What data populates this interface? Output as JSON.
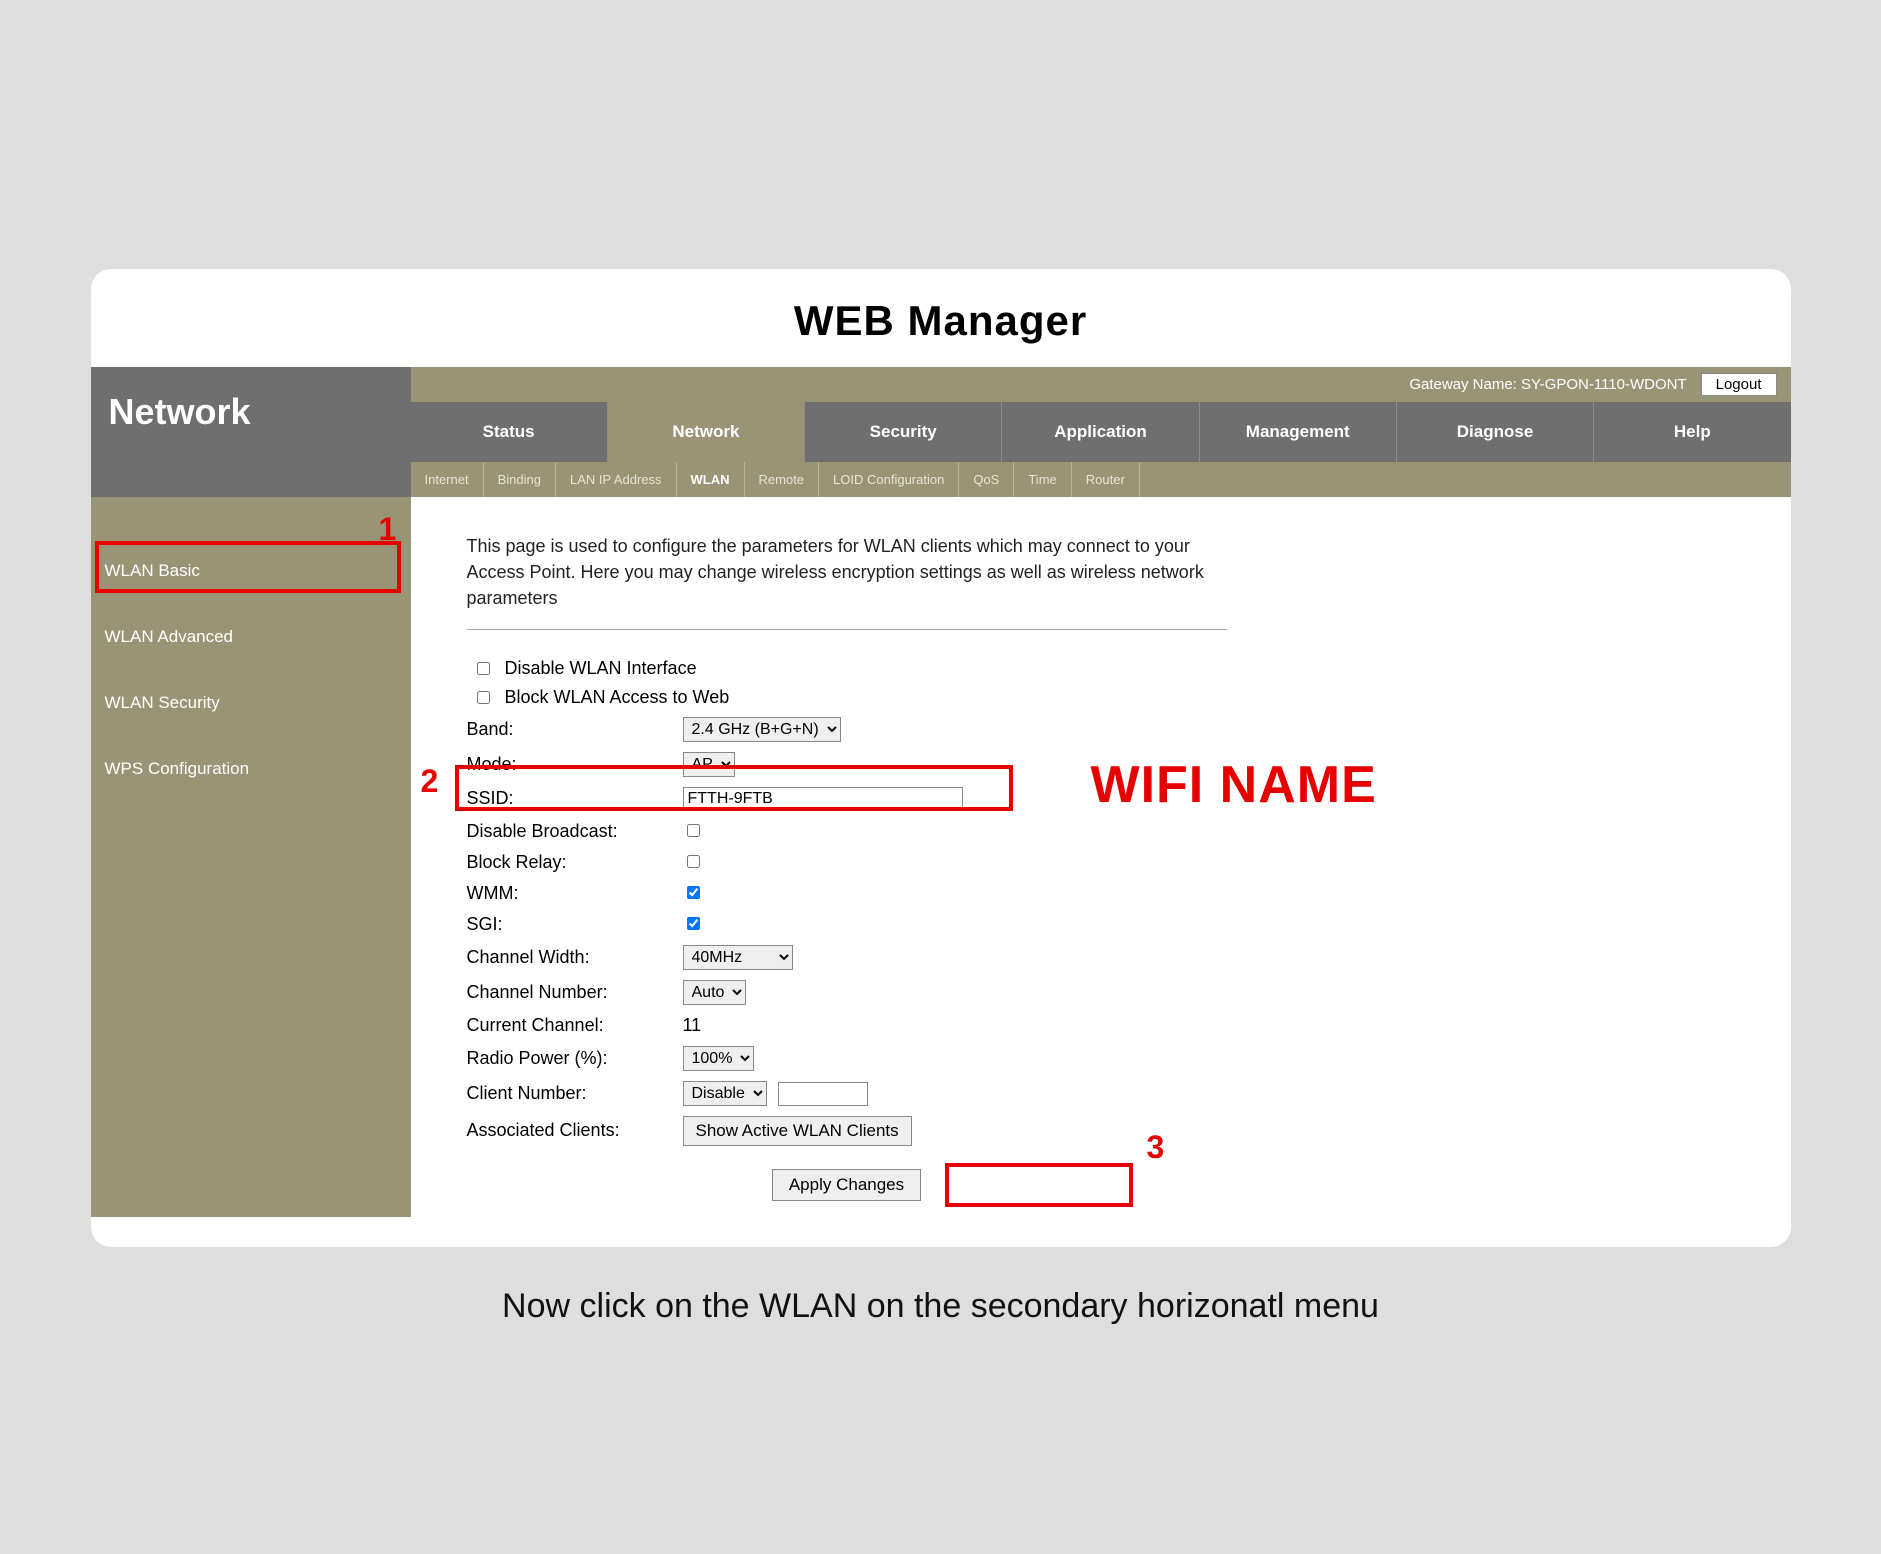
{
  "page_title": "WEB  Manager",
  "gateway": {
    "label": "Gateway Name: SY-GPON-1110-WDONT",
    "logout": "Logout"
  },
  "section_label": "Network",
  "tabs": [
    "Status",
    "Network",
    "Security",
    "Application",
    "Management",
    "Diagnose",
    "Help"
  ],
  "active_tab_index": 1,
  "subtabs": [
    "Internet",
    "Binding",
    "LAN IP Address",
    "WLAN",
    "Remote",
    "LOID Configuration",
    "QoS",
    "Time",
    "Router"
  ],
  "active_subtab_index": 3,
  "sidebar": {
    "items": [
      "WLAN Basic",
      "WLAN Advanced",
      "WLAN Security",
      "WPS Configuration"
    ],
    "active_index": 0
  },
  "description": "This page is used to configure the parameters for WLAN clients which may connect to your Access Point. Here you may change wireless encryption settings as well as wireless network parameters",
  "form": {
    "disable_wlan_label": "Disable WLAN Interface",
    "disable_wlan_checked": false,
    "block_web_label": "Block WLAN Access to Web",
    "block_web_checked": false,
    "band_label": "Band:",
    "band_value": "2.4 GHz (B+G+N)",
    "mode_label": "Mode:",
    "mode_value": "AP",
    "ssid_label": "SSID:",
    "ssid_value": "FTTH-9FTB",
    "disable_broadcast_label": "Disable Broadcast:",
    "disable_broadcast_checked": false,
    "block_relay_label": "Block Relay:",
    "block_relay_checked": false,
    "wmm_label": "WMM:",
    "wmm_checked": true,
    "sgi_label": "SGI:",
    "sgi_checked": true,
    "channel_width_label": "Channel Width:",
    "channel_width_value": "40MHz",
    "channel_number_label": "Channel Number:",
    "channel_number_value": "Auto",
    "current_channel_label": "Current Channel:",
    "current_channel_value": "11",
    "radio_power_label": "Radio Power (%):",
    "radio_power_value": "100%",
    "client_number_label": "Client Number:",
    "client_number_value": "Disable",
    "assoc_clients_label": "Associated Clients:",
    "show_clients_btn": "Show Active WLAN Clients",
    "apply_btn": "Apply Changes"
  },
  "annotations": {
    "num1": "1",
    "num2": "2",
    "num3": "3",
    "wifi_name": "WIFI NAME"
  },
  "instruction": "Now click on the WLAN on the secondary horizonatl menu"
}
